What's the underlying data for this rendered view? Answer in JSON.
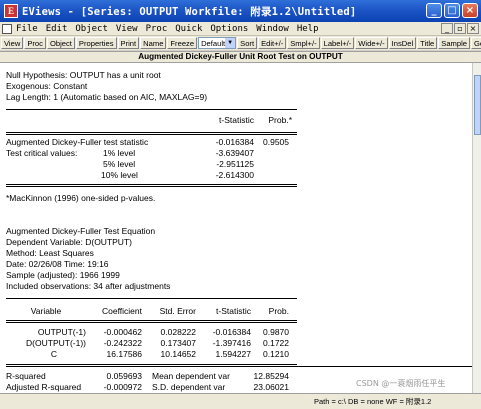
{
  "window": {
    "title": "EViews - [Series: OUTPUT   Workfile: 附录1.2\\Untitled]",
    "app_icon_letter": "E",
    "minimize": "_",
    "maximize": "□",
    "close": "×"
  },
  "menu": [
    "File",
    "Edit",
    "Object",
    "View",
    "Proc",
    "Quick",
    "Options",
    "Window",
    "Help"
  ],
  "mdi": {
    "minimize": "_",
    "restore": "▫",
    "close": "×"
  },
  "toolbar": {
    "left_buttons": [
      "View",
      "Proc",
      "Object",
      "Properties",
      "Print",
      "Name",
      "Freeze"
    ],
    "select_value": "Default",
    "right_buttons": [
      "Sort",
      "Edit+/-",
      "Smpl+/-",
      "Label+/-",
      "Wide+/-",
      "InsDel",
      "Title",
      "Sample",
      "Genr"
    ]
  },
  "header": "Augmented Dickey-Fuller Unit Root Test on OUTPUT",
  "test_info": {
    "null_hypothesis": "Null Hypothesis: OUTPUT has a unit root",
    "exogenous": "Exogenous: Constant",
    "lag_length": "Lag Length: 1 (Automatic based on AIC, MAXLAG=9)"
  },
  "adf_table": {
    "col_tstat": "t-Statistic",
    "col_prob": "Prob.*",
    "adf_label": "Augmented Dickey-Fuller test statistic",
    "adf_tstat": "-0.016384",
    "adf_prob": "0.9505",
    "critical_label": "Test critical values:",
    "critical": [
      {
        "level": "1% level",
        "value": "-3.639407"
      },
      {
        "level": "5% level",
        "value": "-2.951125"
      },
      {
        "level": "10% level",
        "value": "-2.614300"
      }
    ],
    "footnote": "*MacKinnon (1996) one-sided p-values."
  },
  "equation": {
    "title": "Augmented Dickey-Fuller Test Equation",
    "dependent": "Dependent Variable: D(OUTPUT)",
    "method": "Method: Least Squares",
    "date": "Date: 02/26/08   Time: 19:16",
    "sample": "Sample (adjusted): 1966 1999",
    "observations": "Included observations: 34 after adjustments"
  },
  "coef_table": {
    "headers": [
      "Variable",
      "Coefficient",
      "Std. Error",
      "t-Statistic",
      "Prob."
    ],
    "rows": [
      [
        "OUTPUT(-1)",
        "-0.000462",
        "0.028222",
        "-0.016384",
        "0.9870"
      ],
      [
        "D(OUTPUT(-1))",
        "-0.242322",
        "0.173407",
        "-1.397416",
        "0.1722"
      ],
      [
        "C",
        "16.17586",
        "10.14652",
        "1.594227",
        "0.1210"
      ]
    ]
  },
  "stats": [
    {
      "label": "R-squared",
      "value": "0.059693",
      "label2": "Mean dependent var",
      "value2": "12.85294"
    },
    {
      "label": "Adjusted R-squared",
      "value": "-0.000972",
      "label2": "S.D. dependent var",
      "value2": "23.06021"
    }
  ],
  "status": {
    "path": "Path = c:\\   DB = none   WF = 附录1.2"
  },
  "watermark": "CSDN @一蓑烟雨任平生"
}
